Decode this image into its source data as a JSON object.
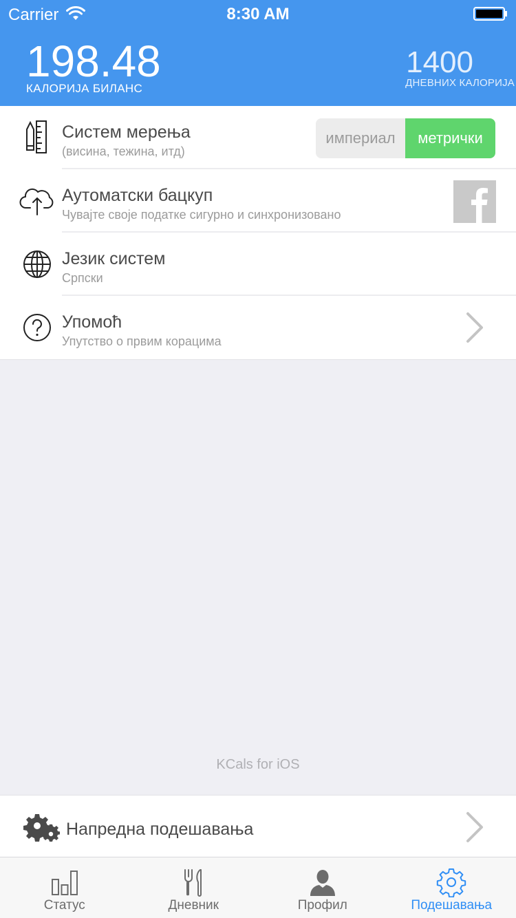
{
  "status_bar": {
    "carrier": "Carrier",
    "time": "8:30 AM"
  },
  "header": {
    "balance_value": "198.48",
    "balance_label": "КАЛОРИЈА БИЛАНС",
    "daily_value": "1400",
    "daily_label": "ДНЕВНИХ КАЛОРИЈА"
  },
  "settings": {
    "units": {
      "title": "Систем мерења",
      "subtitle": "(висина, тежина, итд)",
      "option_imperial": "империал",
      "option_metric": "метрички",
      "selected": "метрички",
      "icon": "ruler-pencil-icon"
    },
    "backup": {
      "title": "Аутоматски бацкуп",
      "subtitle": "Чувајте своје податке сигурно и синхронизовано",
      "icon": "cloud-upload-icon",
      "action_icon": "facebook-icon"
    },
    "language": {
      "title": "Језик систем",
      "subtitle": "Српски",
      "icon": "globe-icon"
    },
    "help": {
      "title": "Упомоћ",
      "subtitle": "Упутство о првим корацима",
      "icon": "question-icon"
    }
  },
  "footer": {
    "app_name": "KCals for iOS"
  },
  "advanced": {
    "label": "Напредна подешавања",
    "icon": "gears-icon"
  },
  "tabbar": {
    "tabs": [
      {
        "label": "Статус",
        "icon": "bar-chart-icon"
      },
      {
        "label": "Дневник",
        "icon": "fork-knife-icon"
      },
      {
        "label": "Профил",
        "icon": "person-icon"
      },
      {
        "label": "Подешавања",
        "icon": "gear-icon"
      }
    ],
    "active_index": 3
  },
  "colors": {
    "header_blue": "#4596ee",
    "toggle_green": "#5fd56d",
    "active_tab": "#2f8ef5"
  }
}
